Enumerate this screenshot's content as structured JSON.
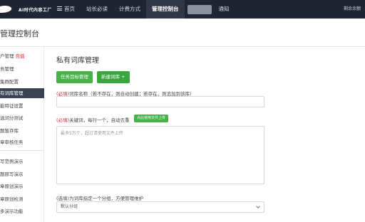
{
  "logo": {
    "text": "AI时代内容工厂"
  },
  "nav": {
    "items": [
      {
        "label": "首页",
        "icon": "menu-icon"
      },
      {
        "label": "站长必读"
      },
      {
        "label": "计费方式"
      },
      {
        "label": "管理控制台"
      },
      {
        "label": ""
      },
      {
        "label": "通知"
      }
    ],
    "user": "剩余余额"
  },
  "page": {
    "title": "管理控制台"
  },
  "sidebar": {
    "items": [
      {
        "label": "户管理",
        "tag": "充值"
      },
      {
        "label": "务管理"
      },
      {
        "label": "集群配置"
      },
      {
        "label": "有词库管理"
      },
      {
        "label": "能特征设置"
      },
      {
        "label": "选词分测试"
      },
      {
        "label": "题暂存库"
      },
      {
        "label": "章审核任务"
      },
      {
        "label": "写范例演示"
      },
      {
        "label": "题原写演示"
      },
      {
        "label": "章原创演示"
      },
      {
        "label": "章原创检测"
      },
      {
        "label": "多演示功能"
      }
    ]
  },
  "main": {
    "section_title": "私有词库管理",
    "buttons": {
      "tasks": "任务目标管理",
      "new_lib": "新建词库 +"
    },
    "name_field": {
      "required": "(必填)",
      "label": "词库名称（若不存在，则自动创建；若存在，则追加到该库）"
    },
    "keywords_field": {
      "required": "(必填)",
      "label": "关键词，每行一个，自动去重",
      "upload_button": "点此使用文件上传",
      "placeholder": "最多5万个，超过请使用文件上传"
    },
    "group_field": {
      "label": "(选填)为词库指定一个分组，方便管理维护",
      "selected": "默认分组"
    }
  }
}
